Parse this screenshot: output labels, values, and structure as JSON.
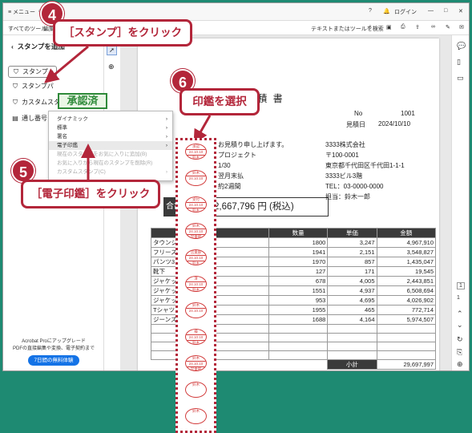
{
  "titlebar": {
    "menu": "≡ メニュー",
    "home_icon": "home-icon",
    "help": "?",
    "bell": "bell-icon",
    "login": "ログイン",
    "minimize": "—",
    "maximize": "□",
    "close": "✕"
  },
  "toolbar2": {
    "all_tools": "すべてのツール",
    "edit_truncated": "編集",
    "search_tools": "テキストまたはツールを検索"
  },
  "sidebar": {
    "title": "スタンプを追加",
    "items": [
      {
        "label": "スタンプ",
        "icon": "stamp-icon"
      },
      {
        "label": "スタンプパ",
        "icon": "stamp-palette-icon"
      },
      {
        "label": "カスタムスタ",
        "icon": "custom-stamp-icon"
      },
      {
        "label": "通し番号",
        "icon": "serial-number-icon"
      }
    ],
    "promo_line1": "Acrobat Proにアップグレード",
    "promo_line2": "PDFの直接編集や変換、電子契約まで",
    "promo_button": "7日間の無料体験"
  },
  "menu": {
    "items": [
      {
        "label": "ダイナミック",
        "has_arrow": true
      },
      {
        "label": "標準",
        "has_arrow": true
      },
      {
        "label": "署名",
        "has_arrow": true
      },
      {
        "label": "電子印鑑",
        "has_arrow": true
      },
      {
        "label": "現在のスタンプをお気に入りに追加(B)",
        "has_arrow": false
      },
      {
        "label": "お気に入りから現在のスタンプを削除(R)",
        "has_arrow": false
      },
      {
        "label": "カスタムスタンプ(C)",
        "has_arrow": true
      }
    ]
  },
  "stamp_preview": "承認済",
  "callouts": {
    "c4": "［スタンプ］をクリック",
    "c5": "［電子印鑑］をクリック",
    "c6": "印鑑を選択",
    "n4": "4",
    "n5": "5",
    "n6": "6"
  },
  "document": {
    "title": "見 積 書",
    "no_label": "No",
    "no_value": "1001",
    "date_label": "見積日",
    "date_value": "2024/10/10",
    "left_lines": [
      "お見積り申し上げます。",
      "プロジェクト",
      "1/30",
      "翌月末払",
      "約2週間"
    ],
    "company": [
      "3333株式会社",
      "〒100-0001",
      "東京都千代田区千代田1-1-1",
      "3333ビル3階",
      "TEL：03-0000-0000",
      "担当：鈴木一郎"
    ],
    "total_label": "合計",
    "total_value": "2,667,796 円 (税込)",
    "table_headers": [
      "品名",
      "数量",
      "単価",
      "金額"
    ],
    "rows": [
      {
        "name": "タウンジ",
        "qty": "1800",
        "price": "3,247",
        "amount": "4,967,910"
      },
      {
        "name": "フリース",
        "qty": "1941",
        "price": "2,151",
        "amount": "3,548,827"
      },
      {
        "name": "パンツ3",
        "qty": "1970",
        "price": "857",
        "amount": "1,435,047"
      },
      {
        "name": "靴下",
        "qty": "127",
        "price": "171",
        "amount": "19,545"
      },
      {
        "name": "ジャケッ",
        "qty": "678",
        "price": "4,005",
        "amount": "2,443,851"
      },
      {
        "name": "ジャケッ",
        "qty": "1551",
        "price": "4,937",
        "amount": "6,508,694"
      },
      {
        "name": "ジャケッ",
        "qty": "953",
        "price": "4,695",
        "amount": "4,026,902"
      },
      {
        "name": "Tシャツ",
        "qty": "1955",
        "price": "465",
        "amount": "772,714"
      },
      {
        "name": "ジーンズ",
        "qty": "1688",
        "price": "4,164",
        "amount": "5,974,507"
      }
    ],
    "subtotal_label": "小計",
    "subtotal_value": "29,697,997"
  },
  "seals": [
    {
      "top": "承認",
      "mid": "24.10.10",
      "bot": "鈴木"
    },
    {
      "top": "鈴木",
      "mid": "24.10.10",
      "bot": ""
    },
    {
      "top": "受付",
      "mid": "24.10.10",
      "bot": "鈴木"
    },
    {
      "top": "鈴木",
      "mid": "24.10.10",
      "bot": "営業部"
    },
    {
      "top": "営業部",
      "mid": "24.10.10",
      "bot": "鈴木"
    },
    {
      "top": "済",
      "mid": "24.10.10",
      "bot": "鈴木"
    },
    {
      "top": "鈴木",
      "mid": "24.10.10",
      "bot": ""
    },
    {
      "top": "検",
      "mid": "24.10.10",
      "bot": "鈴木"
    },
    {
      "top": "鈴木",
      "mid": "24.10.10",
      "bot": "営業部"
    },
    {
      "top": "鈴木",
      "mid": "",
      "bot": ""
    },
    {
      "top": "鈴木",
      "mid": "",
      "bot": ""
    }
  ],
  "page_nav": {
    "page": "1",
    "total": "1"
  },
  "colors": {
    "accent": "#b3263a",
    "background": "#1e8a72",
    "seal": "#d23c3c"
  }
}
